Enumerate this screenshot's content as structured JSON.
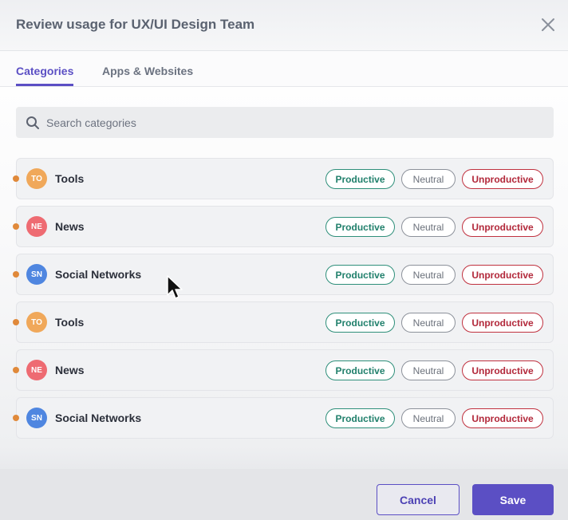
{
  "dialog": {
    "title": "Review usage for UX/UI Design Team"
  },
  "tabs": [
    {
      "label": "Categories",
      "active": true
    },
    {
      "label": "Apps & Websites",
      "active": false
    }
  ],
  "search": {
    "placeholder": "Search categories",
    "value": ""
  },
  "chip_labels": {
    "productive": "Productive",
    "neutral": "Neutral",
    "unproductive": "Unproductive"
  },
  "rows": [
    {
      "initials": "TO",
      "label": "Tools",
      "avatar_color": "#f0a85a"
    },
    {
      "initials": "NE",
      "label": "News",
      "avatar_color": "#ee6b72"
    },
    {
      "initials": "SN",
      "label": "Social Networks",
      "avatar_color": "#4f86e0"
    },
    {
      "initials": "TO",
      "label": "Tools",
      "avatar_color": "#f0a85a"
    },
    {
      "initials": "NE",
      "label": "News",
      "avatar_color": "#ee6b72"
    },
    {
      "initials": "SN",
      "label": "Social Networks",
      "avatar_color": "#4f86e0"
    }
  ],
  "footer": {
    "cancel_label": "Cancel",
    "save_label": "Save"
  },
  "colors": {
    "accent": "#5b4fc4",
    "productive": "#21806c",
    "neutral": "#6a707a",
    "unproductive": "#b2283a",
    "row_dot": "#e0893a"
  },
  "icons": {
    "close": "close-icon",
    "search": "search-icon",
    "cursor": "mouse-pointer-icon"
  }
}
